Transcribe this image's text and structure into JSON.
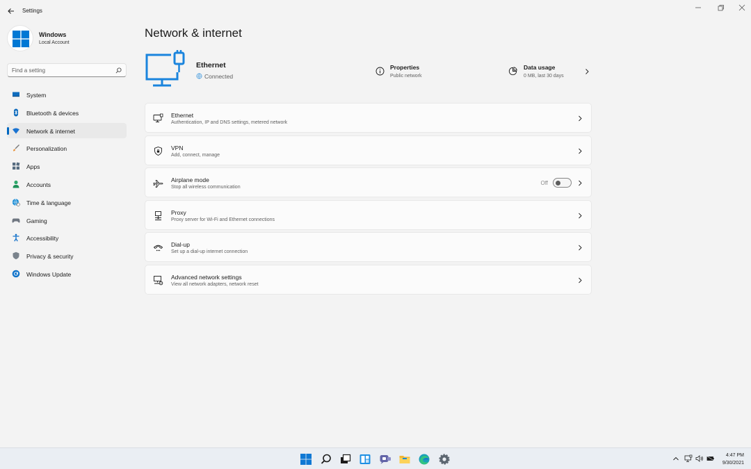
{
  "window": {
    "title": "Settings"
  },
  "profile": {
    "name": "Windows",
    "account": "Local Account"
  },
  "search": {
    "placeholder": "Find a setting"
  },
  "sidebar": {
    "items": [
      {
        "label": "System",
        "icon": "system-icon"
      },
      {
        "label": "Bluetooth & devices",
        "icon": "bluetooth-icon"
      },
      {
        "label": "Network & internet",
        "icon": "wifi-icon",
        "active": true
      },
      {
        "label": "Personalization",
        "icon": "brush-icon"
      },
      {
        "label": "Apps",
        "icon": "apps-icon"
      },
      {
        "label": "Accounts",
        "icon": "person-icon"
      },
      {
        "label": "Time & language",
        "icon": "globe-clock-icon"
      },
      {
        "label": "Gaming",
        "icon": "gamepad-icon"
      },
      {
        "label": "Accessibility",
        "icon": "accessibility-icon"
      },
      {
        "label": "Privacy & security",
        "icon": "shield-icon"
      },
      {
        "label": "Windows Update",
        "icon": "update-icon"
      }
    ]
  },
  "main": {
    "title": "Network & internet",
    "hero": {
      "connection": "Ethernet",
      "status": "Connected",
      "properties": {
        "title": "Properties",
        "subtitle": "Public network"
      },
      "data_usage": {
        "title": "Data usage",
        "subtitle": "0 MB, last 30 days"
      }
    },
    "cards": [
      {
        "title": "Ethernet",
        "subtitle": "Authentication, IP and DNS settings, metered network",
        "icon": "ethernet-monitor-icon"
      },
      {
        "title": "VPN",
        "subtitle": "Add, connect, manage",
        "icon": "vpn-shield-icon"
      },
      {
        "title": "Airplane mode",
        "subtitle": "Stop all wireless communication",
        "icon": "airplane-icon",
        "toggle_label": "Off",
        "toggle_on": false
      },
      {
        "title": "Proxy",
        "subtitle": "Proxy server for Wi-Fi and Ethernet connections",
        "icon": "proxy-icon"
      },
      {
        "title": "Dial-up",
        "subtitle": "Set up a dial-up internet connection",
        "icon": "dialup-icon"
      },
      {
        "title": "Advanced network settings",
        "subtitle": "View all network adapters, network reset",
        "icon": "advanced-network-icon"
      }
    ]
  },
  "taskbar": {
    "apps": [
      "start-icon",
      "search-icon",
      "task-view-icon",
      "widgets-icon",
      "chat-icon",
      "file-explorer-icon",
      "edge-icon",
      "settings-icon"
    ],
    "tray": [
      "chevron-up-icon",
      "network-icon",
      "volume-icon",
      "battery-icon"
    ],
    "time": "4:47 PM",
    "date": "9/30/2021"
  },
  "colors": {
    "accent": "#0067c0",
    "background": "#f3f3f3",
    "card": "#fbfbfb"
  }
}
